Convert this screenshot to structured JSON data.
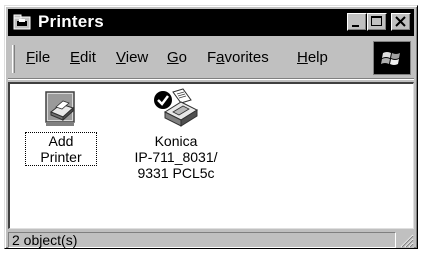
{
  "window": {
    "title": "Printers",
    "icon": "printers-folder-icon",
    "controls": {
      "minimize_icon": "minimize-icon",
      "maximize_icon": "maximize-icon",
      "close_icon": "close-icon"
    }
  },
  "menu": {
    "items": [
      {
        "label": "File",
        "accel": "F",
        "rest": "ile"
      },
      {
        "label": "Edit",
        "accel": "E",
        "rest": "dit"
      },
      {
        "label": "View",
        "accel": "V",
        "rest": "iew"
      },
      {
        "label": "Go",
        "accel": "G",
        "rest": "o"
      },
      {
        "label": "Favorites",
        "pre": "F",
        "accel": "a",
        "rest": "vorites"
      },
      {
        "label": "Help",
        "accel": "H",
        "rest": "elp"
      }
    ],
    "logo_icon": "windows-logo-icon"
  },
  "content": {
    "items": [
      {
        "label": "Add Printer",
        "icon": "add-printer-icon",
        "selected": true
      },
      {
        "label": "Konica\nIP-711_8031/\n9331 PCL5c",
        "icon": "printer-icon",
        "selected": false,
        "default": true
      }
    ]
  },
  "status": {
    "text": "2 object(s)"
  },
  "colors": {
    "titlebar": "#000000",
    "face": "#c0c0c0",
    "content_bg": "#ffffff"
  }
}
